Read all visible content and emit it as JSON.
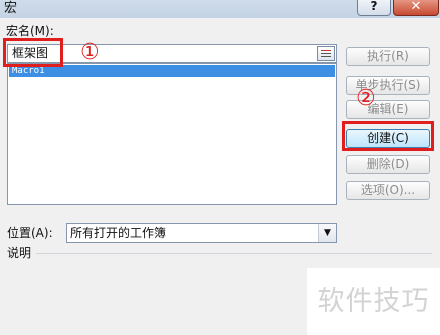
{
  "window": {
    "title": "宏",
    "help_label": "?",
    "close_label": "✕"
  },
  "macro_name": {
    "label": "宏名(M):",
    "value": "框架图"
  },
  "macro_list": {
    "items": [
      "Macro1"
    ]
  },
  "buttons": {
    "run": "执行(R)",
    "step_into": "单步执行(S)",
    "edit": "编辑(E)",
    "create": "创建(C)",
    "delete": "删除(D)",
    "options": "选项(O)..."
  },
  "location": {
    "label": "位置(A):",
    "selected": "所有打开的工作簿"
  },
  "description": {
    "label": "说明"
  },
  "annotations": {
    "marker1": "①",
    "marker2": "②",
    "highlight_color": "#e01e1e"
  },
  "watermark": "软件技巧"
}
